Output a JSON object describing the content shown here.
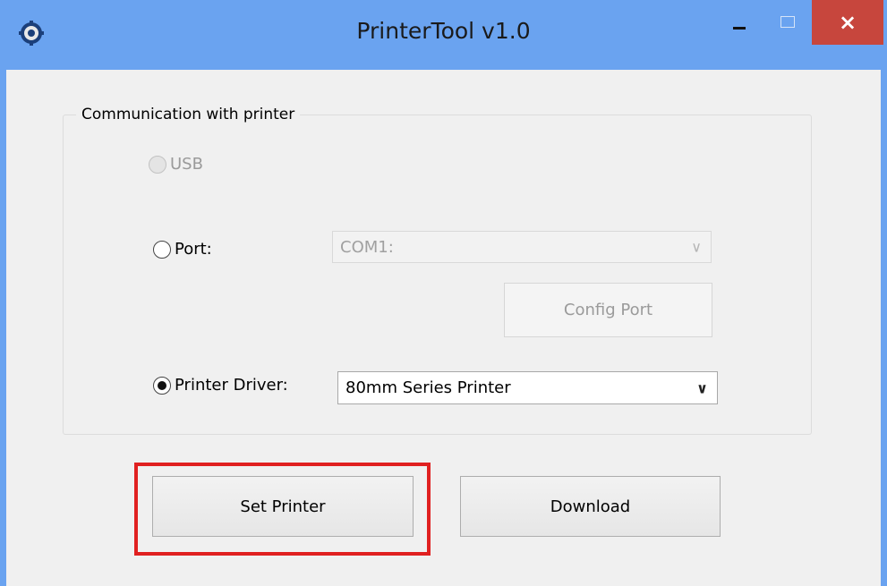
{
  "window": {
    "title": "PrinterTool v1.0",
    "icon": "gear-icon",
    "controls": {
      "minimize": "minimize-icon",
      "maximize": "maximize-icon",
      "close": "×"
    }
  },
  "group": {
    "legend": "Communication with printer",
    "usb": {
      "label": "USB",
      "selected": false,
      "enabled": false
    },
    "port": {
      "label": "Port:",
      "selected": false,
      "combo_value": "COM1:",
      "config_button": "Config Port"
    },
    "driver": {
      "label": "Printer Driver:",
      "selected": true,
      "combo_value": "80mm Series Printer"
    }
  },
  "actions": {
    "set_printer": "Set Printer",
    "download": "Download"
  },
  "colors": {
    "titlebar": "#6aa3f0",
    "close_button": "#c7463d",
    "client": "#f0f0f0",
    "highlight": "#e02020"
  },
  "icons": {
    "combo_arrow": "∨"
  }
}
